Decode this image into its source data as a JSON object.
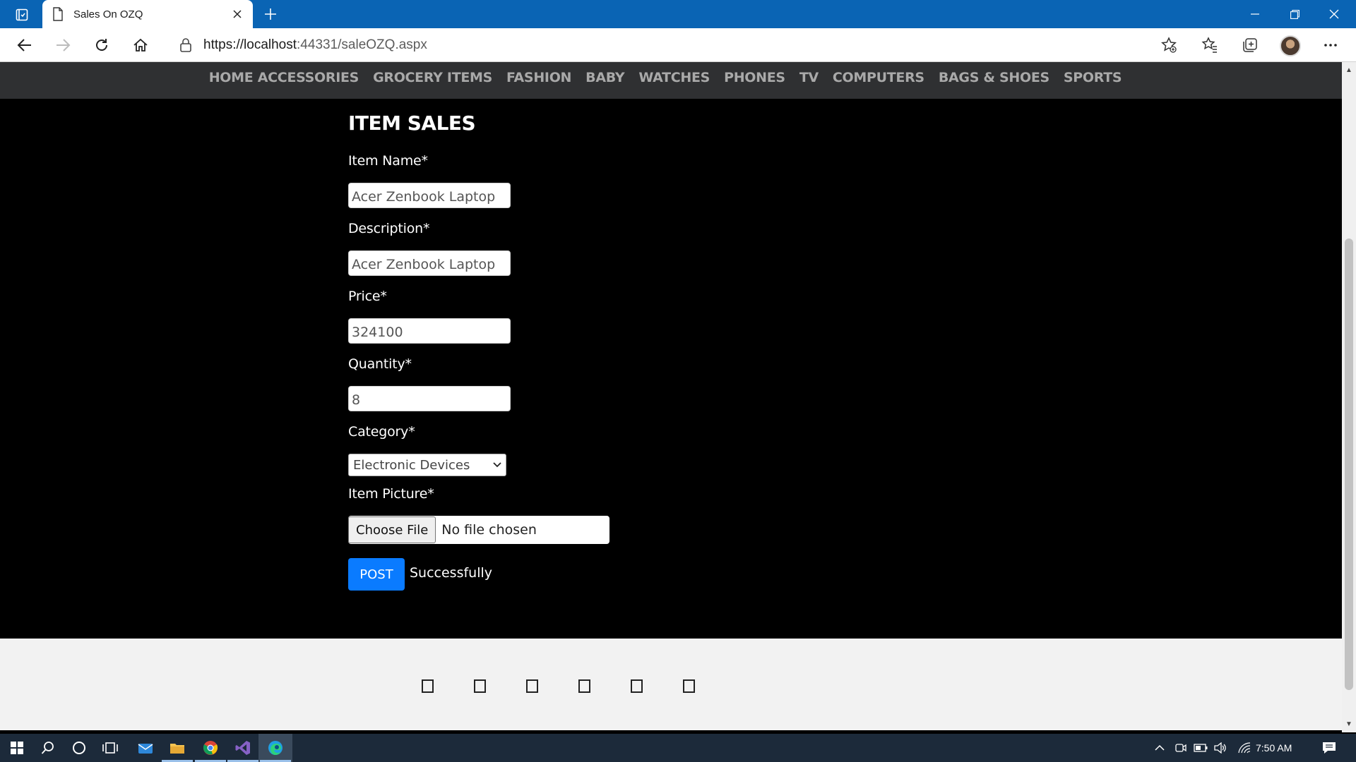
{
  "browser": {
    "tab_title": "Sales On OZQ",
    "url_host": "https://localhost",
    "url_rest": ":44331/saleOZQ.aspx"
  },
  "nav": {
    "items": [
      "HOME ACCESSORIES",
      "GROCERY ITEMS",
      "FASHION",
      "BABY",
      "WATCHES",
      "PHONES",
      "TV",
      "COMPUTERS",
      "BAGS & SHOES",
      "SPORTS"
    ]
  },
  "form": {
    "title": "ITEM SALES",
    "item_name_label": "Item Name*",
    "item_name_value": "Acer Zenbook Laptop",
    "description_label": "Description*",
    "description_value": "Acer Zenbook Laptop",
    "price_label": "Price*",
    "price_value": "324100",
    "quantity_label": "Quantity*",
    "quantity_value": "8",
    "category_label": "Category*",
    "category_value": "Electronic Devices",
    "picture_label": "Item Picture*",
    "choose_file_label": "Choose File",
    "file_status": "No file chosen",
    "post_label": "POST",
    "status_message": "Successfully"
  },
  "taskbar": {
    "clock": "7:50 AM"
  },
  "colors": {
    "titlebar": "#0a64b4",
    "nav_bg": "#2f3032",
    "post_button": "#0a7bff"
  }
}
